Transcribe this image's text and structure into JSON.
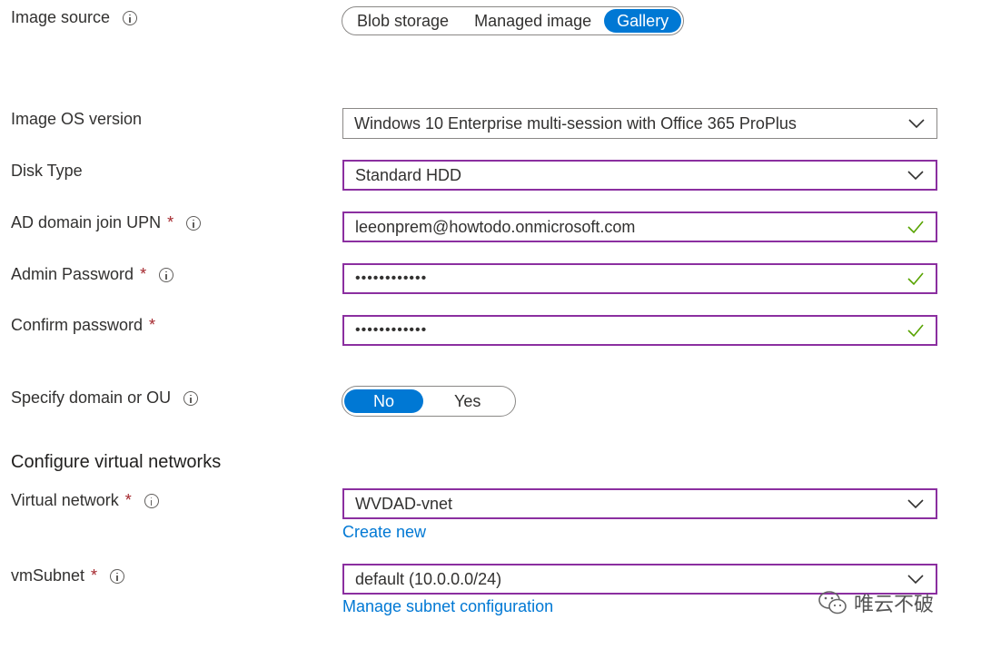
{
  "image_source": {
    "label": "Image source",
    "options": [
      "Blob storage",
      "Managed image",
      "Gallery"
    ],
    "selected": "Gallery"
  },
  "os_version": {
    "label": "Image OS version",
    "value": "Windows 10 Enterprise multi-session with Office 365 ProPlus"
  },
  "disk_type": {
    "label": "Disk Type",
    "value": "Standard HDD"
  },
  "ad_upn": {
    "label": "AD domain join UPN",
    "required": "*",
    "value": "leeonprem@howtodo.onmicrosoft.com"
  },
  "admin_password": {
    "label": "Admin Password",
    "required": "*",
    "value": "••••••••••••"
  },
  "confirm_password": {
    "label": "Confirm password",
    "required": "*",
    "value": "••••••••••••"
  },
  "domain_ou": {
    "label": "Specify domain or OU",
    "options": [
      "No",
      "Yes"
    ],
    "selected": "No"
  },
  "vnet_section": {
    "title": "Configure virtual networks"
  },
  "virtual_network": {
    "label": "Virtual network",
    "required": "*",
    "value": "WVDAD-vnet",
    "link": "Create new"
  },
  "vm_subnet": {
    "label": "vmSubnet",
    "required": "*",
    "value": "default (10.0.0.0/24)",
    "link": "Manage subnet configuration"
  },
  "watermark": {
    "text": "唯云不破",
    "icon": "wechat-icon"
  },
  "colors": {
    "accent": "#0078d4",
    "focus_border": "#8b2fa0",
    "valid": "#57a300",
    "required": "#a4262c"
  }
}
